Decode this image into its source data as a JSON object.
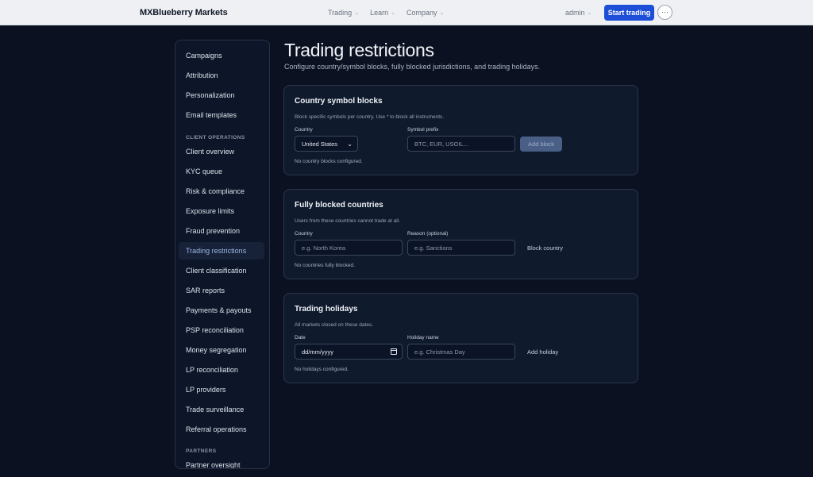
{
  "header": {
    "brand": "MXBlueberry Markets",
    "nav": [
      {
        "label": "Trading",
        "chevron": "chevron-down-icon"
      },
      {
        "label": "Learn",
        "chevron": "chevron-down-icon"
      },
      {
        "label": "Company",
        "chevron": "chevron-down-icon"
      }
    ],
    "user": "admin",
    "cta": "Start trading",
    "more": "···"
  },
  "sidebar": {
    "items": [
      {
        "label": "Campaigns"
      },
      {
        "label": "Attribution"
      },
      {
        "label": "Personalization"
      },
      {
        "label": "Email templates"
      }
    ],
    "section_client": "CLIENT OPERATIONS",
    "client_items": [
      {
        "label": "Client overview"
      },
      {
        "label": "KYC queue"
      },
      {
        "label": "Risk & compliance"
      },
      {
        "label": "Exposure limits"
      },
      {
        "label": "Fraud prevention"
      },
      {
        "label": "Trading restrictions",
        "active": true
      },
      {
        "label": "Client classification"
      },
      {
        "label": "SAR reports"
      },
      {
        "label": "Payments & payouts"
      },
      {
        "label": "PSP reconciliation"
      },
      {
        "label": "Money segregation"
      },
      {
        "label": "LP reconciliation"
      },
      {
        "label": "LP providers"
      },
      {
        "label": "Trade surveillance"
      },
      {
        "label": "Referral operations"
      }
    ],
    "section_partners": "PARTNERS",
    "partner_items": [
      {
        "label": "Partner oversight"
      }
    ]
  },
  "page": {
    "title": "Trading restrictions",
    "subtitle": "Configure country/symbol blocks, fully blocked jurisdictions, and trading holidays."
  },
  "symbol_blocks": {
    "title": "Country symbol blocks",
    "description": "Block specific symbols per country. Use * to block all instruments.",
    "country_label": "Country",
    "country_value": "United States",
    "prefix_label": "Symbol prefix",
    "prefix_placeholder": "BTC, EUR, USOIL...",
    "button": "Add block",
    "empty": "No country blocks configured."
  },
  "blocked_countries": {
    "title": "Fully blocked countries",
    "description": "Users from these countries cannot trade at all.",
    "country_label": "Country",
    "country_placeholder": "e.g. North Korea",
    "reason_label": "Reason (optional)",
    "reason_placeholder": "e.g. Sanctions",
    "button": "Block country",
    "empty": "No countries fully blocked."
  },
  "holidays": {
    "title": "Trading holidays",
    "description": "All markets closed on these dates.",
    "date_label": "Date",
    "date_value": "dd/mm/yyyy",
    "name_label": "Holiday name",
    "name_placeholder": "e.g. Christmas Day",
    "button": "Add holiday",
    "empty": "No holidays configured."
  }
}
